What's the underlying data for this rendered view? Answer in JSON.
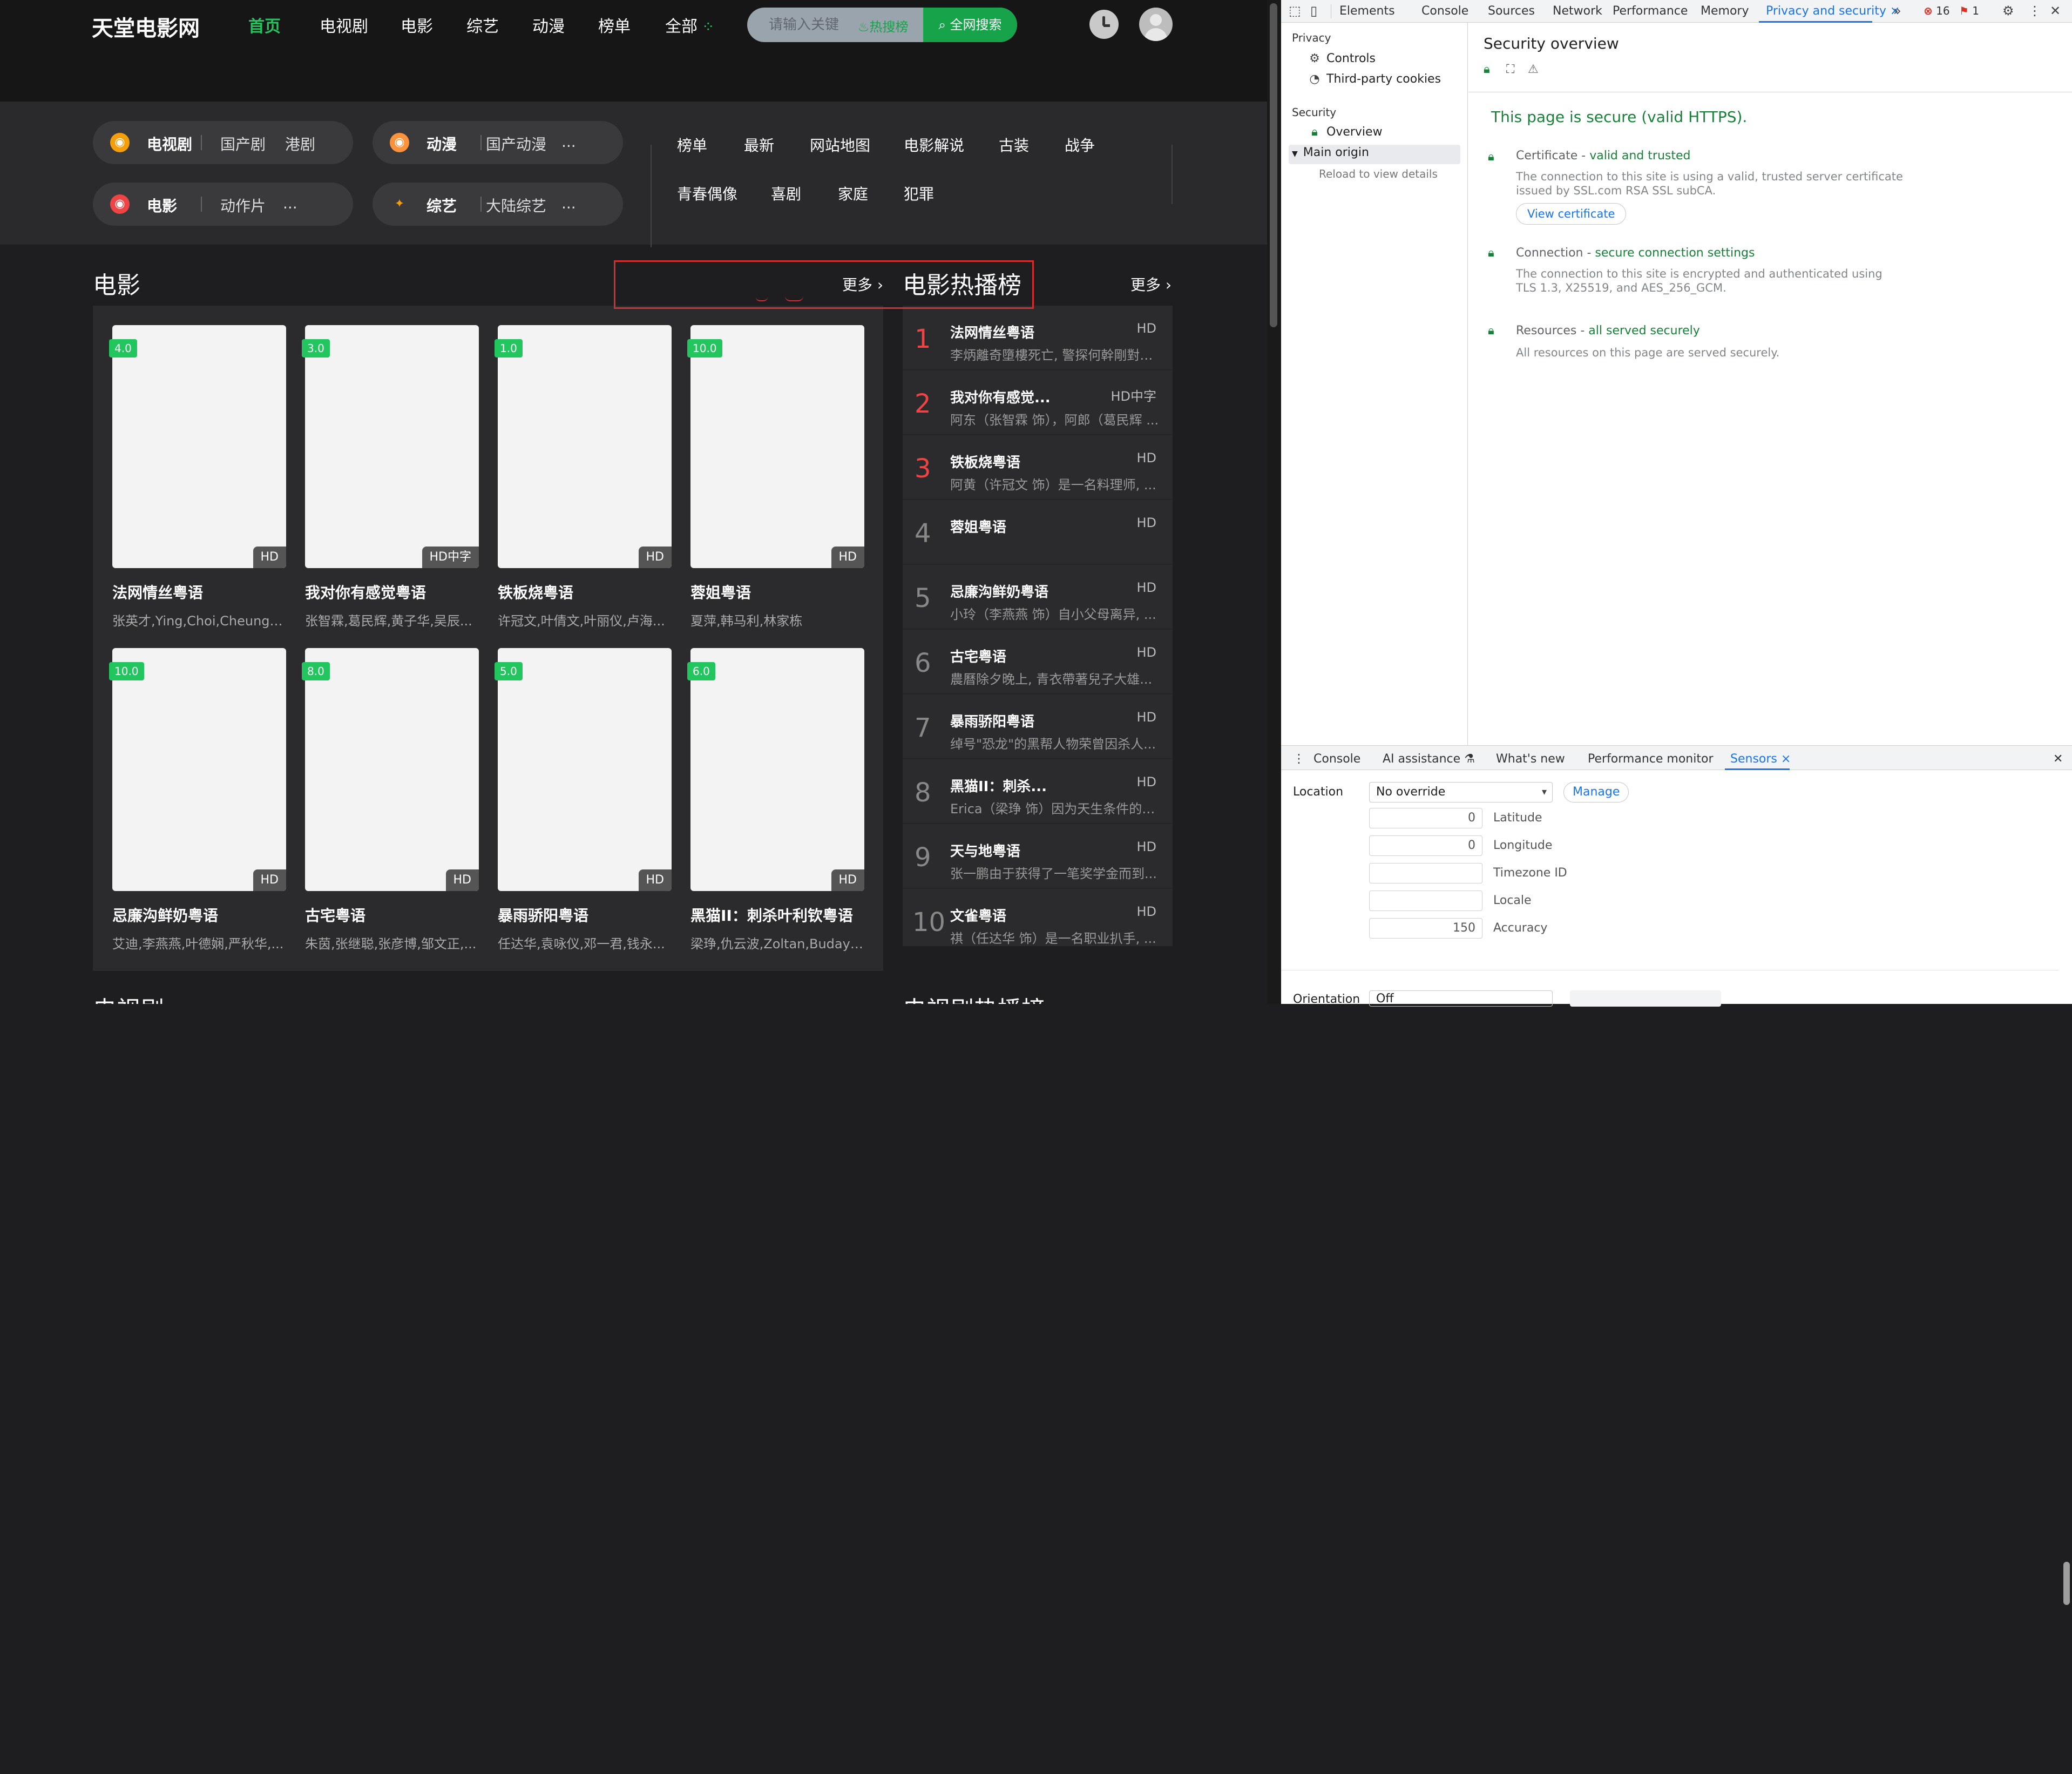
{
  "site": {
    "logo": "天堂电影网",
    "nav": [
      "首页",
      "电视剧",
      "电影",
      "综艺",
      "动漫",
      "榜单",
      "全部"
    ],
    "search": {
      "placeholder": "请输入关键",
      "hot": "热搜榜",
      "button": "全网搜索"
    },
    "categories": [
      {
        "name": "电视剧",
        "subs": [
          "国产剧",
          "港剧"
        ],
        "icon": "tv-face-icon"
      },
      {
        "name": "动漫",
        "subs": [
          "国产动漫",
          "..."
        ],
        "icon": "cat-face-icon"
      },
      {
        "name": "电影",
        "subs": [
          "动作片",
          "..."
        ],
        "icon": "movie-face-icon"
      },
      {
        "name": "综艺",
        "subs": [
          "大陆综艺",
          "..."
        ],
        "icon": "wand-icon"
      }
    ],
    "tags_row1": [
      "榜单",
      "最新",
      "网站地图",
      "电影解说",
      "古装",
      "战争"
    ],
    "tags_row2": [
      "青春偶像",
      "喜剧",
      "家庭",
      "犯罪"
    ],
    "movies_section": {
      "title": "电影",
      "more": "更多"
    },
    "movies": [
      {
        "rating": "4.0",
        "quality": "HD",
        "title": "法网情丝粤语",
        "cast": "张英才,Ying,Choi,Cheung,..."
      },
      {
        "rating": "3.0",
        "quality": "HD中字",
        "title": "我对你有感觉粤语",
        "cast": "张智霖,葛民辉,黄子华,吴辰..."
      },
      {
        "rating": "1.0",
        "quality": "HD",
        "title": "铁板烧粤语",
        "cast": "许冠文,叶倩文,叶丽仪,卢海..."
      },
      {
        "rating": "10.0",
        "quality": "HD",
        "title": "蓉姐粤语",
        "cast": "夏萍,韩马利,林家栋"
      },
      {
        "rating": "10.0",
        "quality": "HD",
        "title": "忌廉沟鲜奶粤语",
        "cast": "艾迪,李燕燕,叶德娴,严秋华,..."
      },
      {
        "rating": "8.0",
        "quality": "HD",
        "title": "古宅粤语",
        "cast": "朱茵,张继聪,张彦博,邹文正,..."
      },
      {
        "rating": "5.0",
        "quality": "HD",
        "title": "暴雨骄阳粤语",
        "cast": "任达华,袁咏仪,邓一君,钱永..."
      },
      {
        "rating": "6.0",
        "quality": "HD",
        "title": "黑猫II：刺杀叶利钦粤语",
        "cast": "梁琤,仇云波,Zoltan,Buday,..."
      }
    ],
    "hot_section": {
      "title": "电影热播榜",
      "more": "更多"
    },
    "hot": [
      {
        "rank": "1",
        "title": "法网情丝粤语",
        "q": "HD",
        "desc": "李炳離奇墮樓死亡, 警探何幹剛對婚昔..."
      },
      {
        "rank": "2",
        "title": "我对你有感觉...",
        "q": "HD中字",
        "desc": "阿东（张智霖 饰），阿郎（葛民辉 ..."
      },
      {
        "rank": "3",
        "title": "铁板烧粤语",
        "q": "HD",
        "desc": "阿黄（许冠文 饰）是一名料理师, ..."
      },
      {
        "rank": "4",
        "title": "蓉姐粤语",
        "q": "HD",
        "desc": ""
      },
      {
        "rank": "5",
        "title": "忌廉沟鲜奶粤语",
        "q": "HD",
        "desc": "小玲（李燕燕 饰）自小父母离异, ..."
      },
      {
        "rank": "6",
        "title": "古宅粤语",
        "q": "HD",
        "desc": "農曆除夕晚上, 青衣帶著兒子大雄..."
      },
      {
        "rank": "7",
        "title": "暴雨骄阳粤语",
        "q": "HD",
        "desc": "绰号\"恐龙\"的黑帮人物荣曾因杀人..."
      },
      {
        "rank": "8",
        "title": "黑猫II：刺杀...",
        "q": "HD",
        "desc": "Erica（梁琤 饰）因为天生条件的天..."
      },
      {
        "rank": "9",
        "title": "天与地粤语",
        "q": "HD",
        "desc": "张一鹏由于获得了一笔奖学金而到..."
      },
      {
        "rank": "10",
        "title": "文雀粤语",
        "q": "HD",
        "desc": "祺（任达华 饰）是一名职业扒手, ..."
      }
    ],
    "bottom_left": "电视剧",
    "bottom_right": "电视剧热播榜"
  },
  "devtools": {
    "tabs": [
      "Elements",
      "Console",
      "Sources",
      "Network",
      "Performance",
      "Memory",
      "Privacy and security"
    ],
    "errors": "16",
    "warnings": "1",
    "side": {
      "privacy": "Privacy",
      "controls": "Controls",
      "cookies": "Third-party cookies",
      "security": "Security",
      "overview": "Overview",
      "main_origin": "Main origin",
      "reload": "Reload to view details"
    },
    "main": {
      "title": "Security overview",
      "secure": "This page is secure (valid HTTPS).",
      "cert_label": "Certificate - ",
      "cert_status": "valid and trusted",
      "cert_desc": "The connection to this site is using a valid, trusted server certificate issued by SSL.com RSA SSL subCA.",
      "view_cert": "View certificate",
      "conn_label": "Connection - ",
      "conn_status": "secure connection settings",
      "conn_desc": "The connection to this site is encrypted and authenticated using TLS 1.3, X25519, and AES_256_GCM.",
      "res_label": "Resources - ",
      "res_status": "all served securely",
      "res_desc": "All resources on this page are served securely."
    },
    "drawer_tabs": [
      "Console",
      "AI assistance",
      "What's new",
      "Performance monitor",
      "Sensors"
    ],
    "sensors": {
      "location_label": "Location",
      "location_value": "No override",
      "manage": "Manage",
      "latitude": {
        "value": "0",
        "label": "Latitude"
      },
      "longitude": {
        "value": "0",
        "label": "Longitude"
      },
      "timezone": {
        "value": "",
        "label": "Timezone ID"
      },
      "locale": {
        "value": "",
        "label": "Locale"
      },
      "accuracy": {
        "value": "150",
        "label": "Accuracy"
      },
      "orientation_label": "Orientation",
      "orientation_value": "Off"
    }
  }
}
